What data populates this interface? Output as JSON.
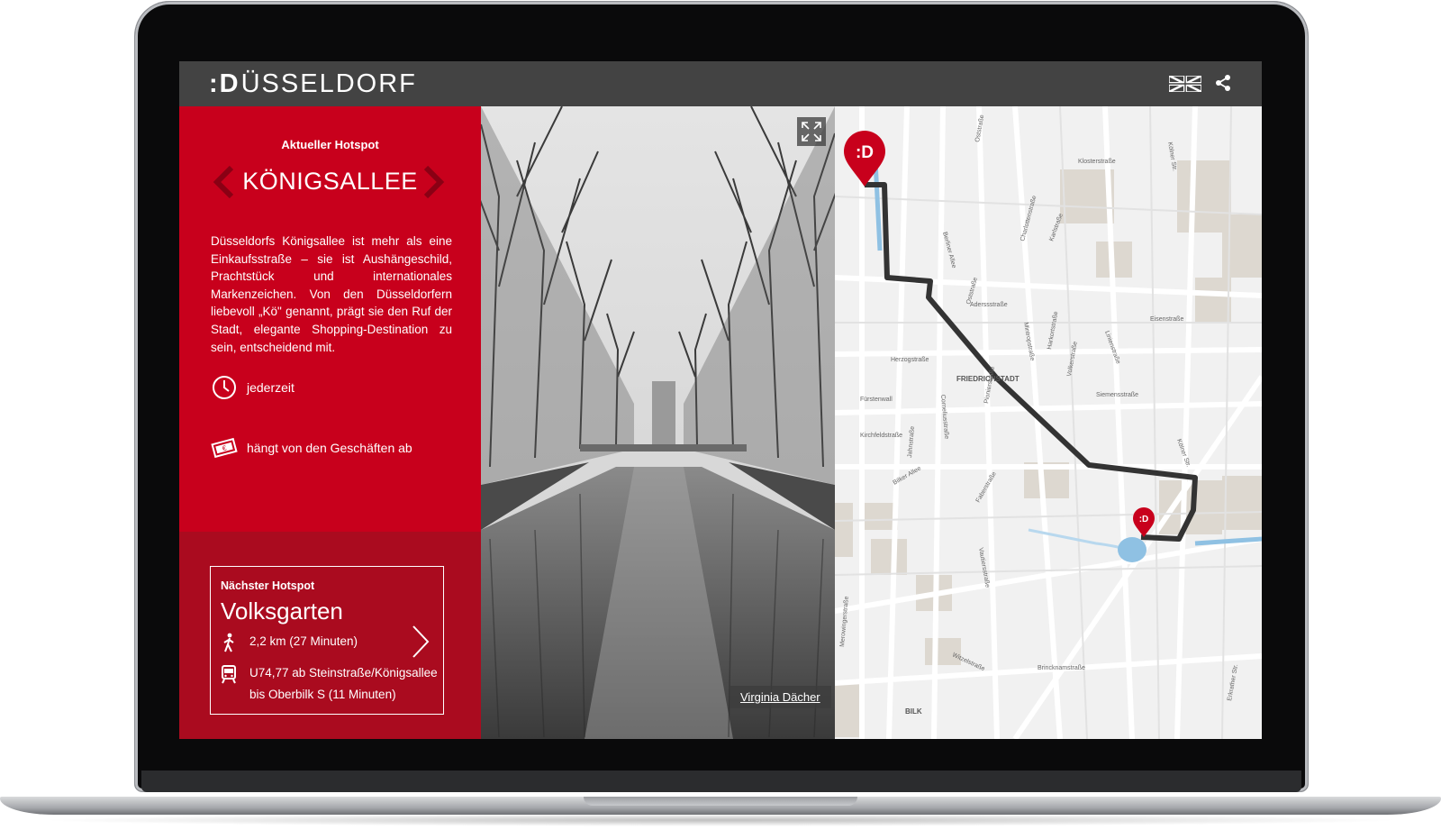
{
  "app": {
    "logo_text": "ÜSSELDORF",
    "logo_prefix": ":D"
  },
  "header": {
    "language_icon": "uk-flag-icon",
    "share_icon": "share-icon"
  },
  "current": {
    "label": "Aktueller Hotspot",
    "title": "KÖNIGSALLEE",
    "description": "Düsseldorfs Königsallee ist mehr als eine Einkaufsstraße – sie ist Aushängeschild, Prachtstück und internationales Markenzeichen. Von den Düsseldorfern liebevoll „Kö\" genannt, prägt sie den Ruf der Stadt, elegante Shopping-Destination zu sein, entscheidend mit.",
    "opening": "jederzeit",
    "price": "hängt von den Geschäften ab"
  },
  "next": {
    "label": "Nächster Hotspot",
    "title": "Volksgarten",
    "walk": "2,2 km (27 Minuten)",
    "transit_line1": "U74,77 ab Steinstraße/Königsallee",
    "transit_line2": "bis Oberbilk S (11 Minuten)"
  },
  "photo": {
    "credit": "Virginia Dächer"
  },
  "map": {
    "district_label": "FRIEDRICHSTADT",
    "bottom_label": "BILK",
    "streets": [
      "Klosterstraße",
      "Oststraße",
      "Kölner Str.",
      "Charlottenstraße",
      "Berliner Allee",
      "Karlstraße",
      "Oststraße",
      "Aderssstraße",
      "Mintropstraße",
      "Harkortstraße",
      "Eisenstraße",
      "Herzogstraße",
      "Fürstenwall",
      "Kirchfeldstraße",
      "Jahnstraße",
      "Pionierstraße",
      "Siemensstraße",
      "Linienstraße",
      "Bilker Allee",
      "Corneliusstraße",
      "Volkerstraße",
      "Kölner Str.",
      "Faberstraße",
      "Vautiersstraße",
      "Merowingerstraße",
      "Brincknamstraße",
      "Witzelstraße",
      "Erkrather Str."
    ],
    "marker_label": ":D"
  },
  "colors": {
    "brand_red": "#c8001c",
    "dark_red": "#aa0b1f",
    "topbar": "#434343"
  }
}
